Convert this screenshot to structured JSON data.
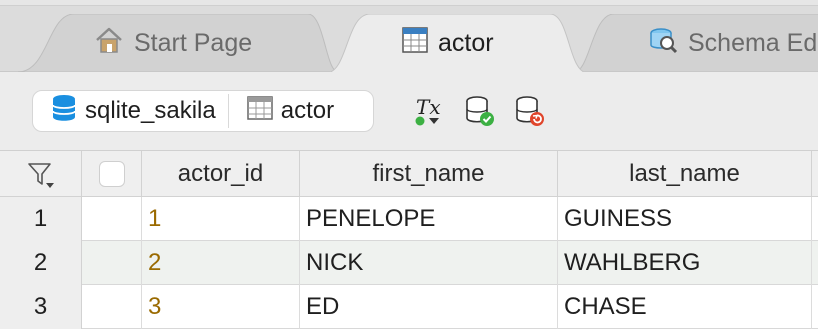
{
  "tabs": [
    {
      "label": "Start Page",
      "icon": "home-icon"
    },
    {
      "label": "actor",
      "icon": "table-icon"
    },
    {
      "label": "Schema Ed",
      "icon": "schema-icon"
    }
  ],
  "toolbar": {
    "connection_label": "sqlite_sakila",
    "table_label": "actor",
    "tx_label": "Tx",
    "icons": [
      "database-icon",
      "table-icon",
      "transaction-mode-icon",
      "commit-icon",
      "rollback-icon"
    ]
  },
  "grid": {
    "columns": [
      "actor_id",
      "first_name",
      "last_name"
    ],
    "rows": [
      {
        "num": "1",
        "actor_id": "1",
        "first_name": "PENELOPE",
        "last_name": "GUINESS"
      },
      {
        "num": "2",
        "actor_id": "2",
        "first_name": "NICK",
        "last_name": "WAHLBERG"
      },
      {
        "num": "3",
        "actor_id": "3",
        "first_name": "ED",
        "last_name": "CHASE"
      }
    ]
  },
  "colors": {
    "id_value": "#9a6a00",
    "db_blue": "#1a8fe0",
    "commit_green": "#3cb043",
    "rollback_red": "#e0452b"
  }
}
